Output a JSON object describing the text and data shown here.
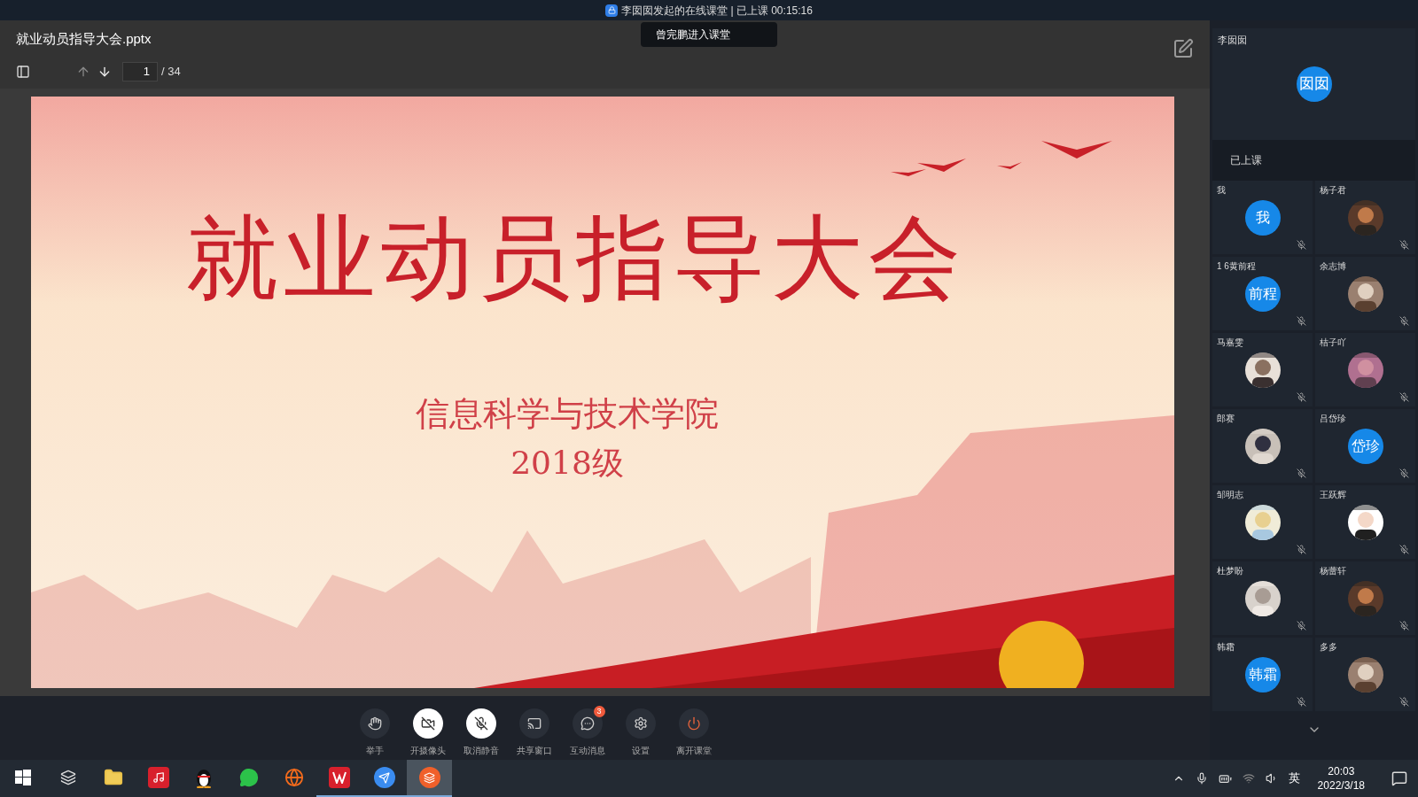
{
  "title_bar": {
    "title": "李囡囡发起的在线课堂 | 已上课 00:15:16"
  },
  "notification": {
    "text": "曾完鹏进入课堂"
  },
  "document": {
    "file_name": "就业动员指导大会.pptx",
    "page": "1",
    "page_total": "/ 34"
  },
  "slide": {
    "title": "就业动员指导大会",
    "subtitle": "信息科学与技术学院",
    "year": "2018级"
  },
  "toolbar": [
    {
      "kind": "hand",
      "label": "举手",
      "on": false
    },
    {
      "kind": "camera",
      "label": "开摄像头",
      "on": true
    },
    {
      "kind": "mic",
      "label": "取消静音",
      "on": true
    },
    {
      "kind": "share",
      "label": "共享窗口",
      "on": false
    },
    {
      "kind": "chat",
      "label": "互动消息",
      "on": false,
      "badge": "3"
    },
    {
      "kind": "settings",
      "label": "设置",
      "on": false
    },
    {
      "kind": "power",
      "label": "离开课堂",
      "on": false
    }
  ],
  "teacher": {
    "name": "李囡囡",
    "avatar": "囡囡"
  },
  "section_label": "已上课",
  "participants": [
    {
      "name": "我",
      "kind": "initials",
      "avatar": "我"
    },
    {
      "name": "杨子君",
      "kind": "picture"
    },
    {
      "name": "1 6黄前程",
      "kind": "initials",
      "avatar": "前程"
    },
    {
      "name": "余志博",
      "kind": "picture"
    },
    {
      "name": "马嘉雯",
      "kind": "picture"
    },
    {
      "name": "桔子吖",
      "kind": "picture"
    },
    {
      "name": "郎赛",
      "kind": "picture"
    },
    {
      "name": "吕岱珍",
      "kind": "initials",
      "avatar": "岱珍"
    },
    {
      "name": "邹明志",
      "kind": "picture"
    },
    {
      "name": "王跃辉",
      "kind": "picture"
    },
    {
      "name": "杜梦盼",
      "kind": "picture"
    },
    {
      "name": "杨蕾轩",
      "kind": "picture"
    },
    {
      "name": "韩霜",
      "kind": "initials",
      "avatar": "韩霜"
    },
    {
      "name": "多多",
      "kind": "picture"
    }
  ],
  "taskbar": {
    "apps": [
      {
        "kind": "start",
        "running": false,
        "active": false
      },
      {
        "kind": "taskview",
        "running": false,
        "active": false
      },
      {
        "kind": "folder",
        "running": false,
        "active": false
      },
      {
        "kind": "music",
        "running": false,
        "active": false
      },
      {
        "kind": "penguin",
        "running": false,
        "active": false
      },
      {
        "kind": "chat",
        "running": false,
        "active": false
      },
      {
        "kind": "browser",
        "running": false,
        "active": false
      },
      {
        "kind": "office",
        "running": true,
        "active": false
      },
      {
        "kind": "bird",
        "running": true,
        "active": false
      },
      {
        "kind": "classroom",
        "running": true,
        "active": true
      }
    ],
    "ime": "英",
    "time": "20:03",
    "date": "2022/3/18"
  }
}
